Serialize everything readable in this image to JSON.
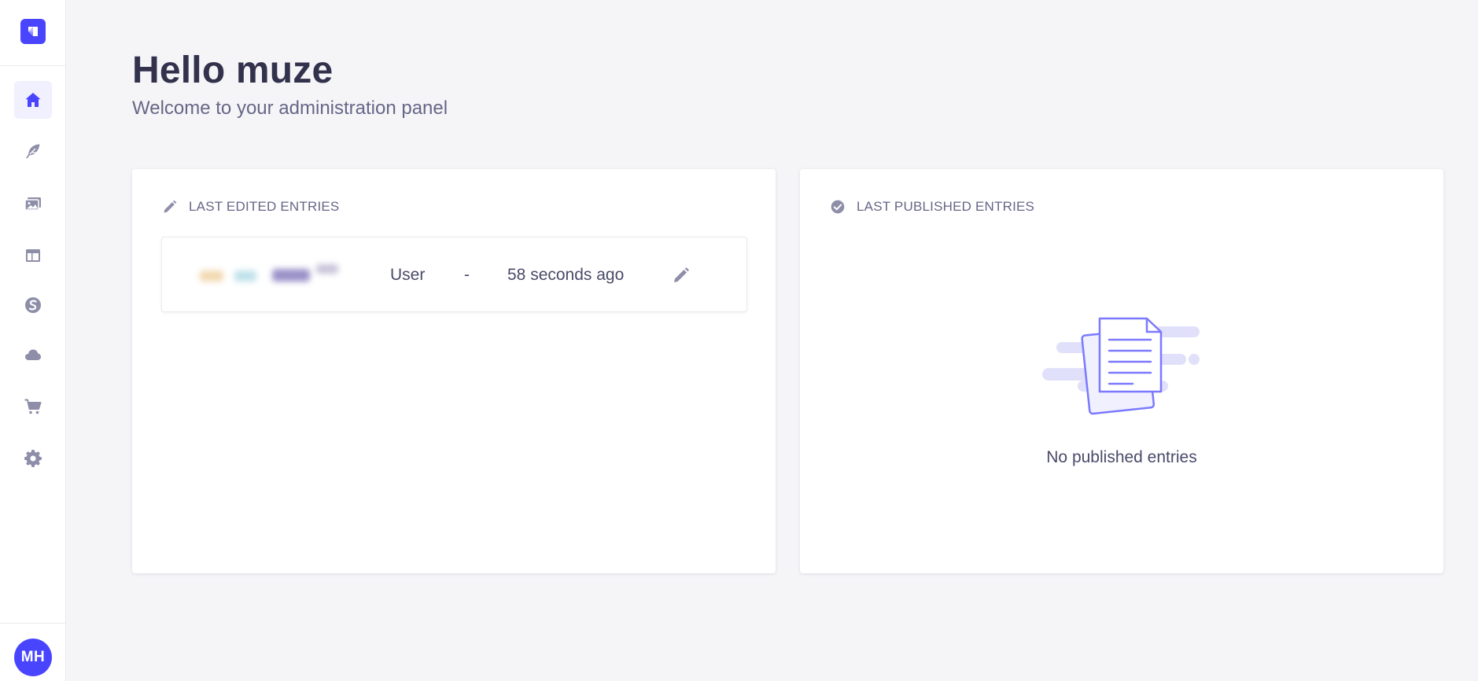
{
  "sidebar": {
    "logo_icon": "strapi-logo-icon",
    "items": [
      {
        "name": "home",
        "icon": "home-icon",
        "active": true
      },
      {
        "name": "content-manager",
        "icon": "feather-icon",
        "active": false
      },
      {
        "name": "media-library",
        "icon": "images-icon",
        "active": false
      },
      {
        "name": "content-type-builder",
        "icon": "layout-icon",
        "active": false
      },
      {
        "name": "plugin-s",
        "icon": "s-plugin-icon",
        "active": false
      },
      {
        "name": "cloud",
        "icon": "cloud-icon",
        "active": false
      },
      {
        "name": "marketplace",
        "icon": "cart-icon",
        "active": false
      },
      {
        "name": "settings",
        "icon": "gear-icon",
        "active": false
      }
    ],
    "user_initials": "MH"
  },
  "header": {
    "title": "Hello muze",
    "subtitle": "Welcome to your administration panel"
  },
  "last_edited": {
    "heading": "LAST EDITED ENTRIES",
    "entries": [
      {
        "type": "User",
        "separator": "-",
        "time": "58 seconds ago"
      }
    ]
  },
  "last_published": {
    "heading": "LAST PUBLISHED ENTRIES",
    "empty_text": "No published entries"
  },
  "colors": {
    "primary": "#4945ff",
    "icon_gray": "#8e8ea9",
    "background": "#f5f5f8",
    "illustration_light": "#e0e0fa",
    "illustration_stroke": "#7b79ff"
  }
}
